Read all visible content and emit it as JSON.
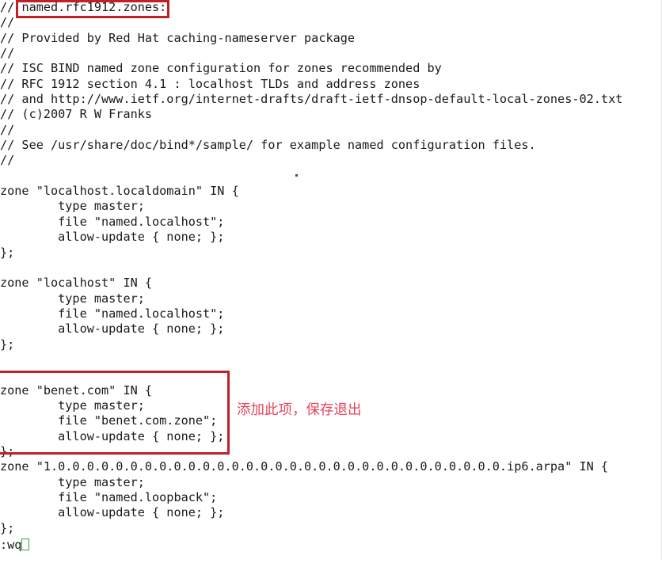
{
  "editor": {
    "filename_label": "named.rfc1912.zones:",
    "background": "#ffffff",
    "text_color": "#1a1a1a",
    "highlight_color": "#c02026",
    "annotation_color": "#e8425a",
    "cursor_color": "#2e9e4f"
  },
  "annotation": {
    "text": "添加此项，保存退出"
  },
  "lines": [
    "// ",
    "//",
    "// Provided by Red Hat caching-nameserver package",
    "//",
    "// ISC BIND named zone configuration for zones recommended by",
    "// RFC 1912 section 4.1 : localhost TLDs and address zones",
    "// and http://www.ietf.org/internet-drafts/draft-ietf-dnsop-default-local-zones-02.txt",
    "// (c)2007 R W Franks",
    "//",
    "// See /usr/share/doc/bind*/sample/ for example named configuration files.",
    "//",
    "",
    "zone \"localhost.localdomain\" IN {",
    "        type master;",
    "        file \"named.localhost\";",
    "        allow-update { none; };",
    "};",
    "",
    "zone \"localhost\" IN {",
    "        type master;",
    "        file \"named.localhost\";",
    "        allow-update { none; };",
    "};",
    "",
    "",
    "zone \"benet.com\" IN {",
    "        type master;",
    "        file \"benet.com.zone\";",
    "        allow-update { none; };",
    "};",
    "zone \"1.0.0.0.0.0.0.0.0.0.0.0.0.0.0.0.0.0.0.0.0.0.0.0.0.0.0.0.0.0.0.0.ip6.arpa\" IN {",
    "        type master;",
    "        file \"named.loopback\";",
    "        allow-update { none; };",
    "};",
    "",
    ""
  ],
  "status_line": {
    "command": ":wq"
  }
}
